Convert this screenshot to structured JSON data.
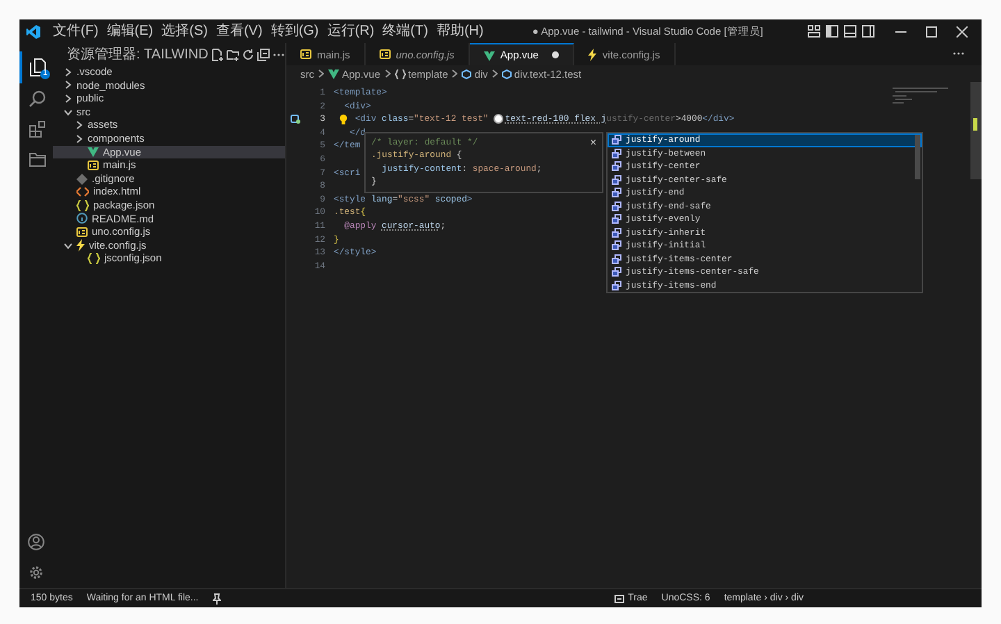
{
  "window": {
    "title": "● App.vue - tailwind - Visual Studio Code [管理员]",
    "menus": [
      "文件(F)",
      "编辑(E)",
      "选择(S)",
      "查看(V)",
      "转到(G)",
      "运行(R)",
      "终端(T)",
      "帮助(H)"
    ]
  },
  "activity_bar": {
    "items": [
      {
        "kind": "files",
        "selected": true,
        "badge": "1"
      },
      {
        "kind": "search",
        "selected": false
      },
      {
        "kind": "extensions",
        "selected": false
      },
      {
        "kind": "folder",
        "selected": false
      }
    ],
    "bottom": [
      {
        "kind": "account"
      },
      {
        "kind": "settings"
      }
    ]
  },
  "explorer": {
    "title": "资源管理器: TAILWIND",
    "items": [
      {
        "label": ".vscode",
        "kind": "folder",
        "expanded": false,
        "selected": false
      },
      {
        "label": "node_modules",
        "kind": "folder",
        "expanded": false,
        "selected": false
      },
      {
        "label": "public",
        "kind": "folder",
        "expanded": false,
        "selected": false
      },
      {
        "label": "src",
        "kind": "folder",
        "expanded": true,
        "selected": false,
        "children": [
          {
            "label": "assets",
            "kind": "folder",
            "expanded": false,
            "selected": false
          },
          {
            "label": "components",
            "kind": "folder",
            "expanded": false,
            "selected": false
          },
          {
            "label": "App.vue",
            "kind": "vue",
            "selected": true
          },
          {
            "label": "main.js",
            "kind": "js",
            "selected": false
          }
        ]
      },
      {
        "label": ".gitignore",
        "kind": "git",
        "selected": false
      },
      {
        "label": "index.html",
        "kind": "html",
        "selected": false
      },
      {
        "label": "package.json",
        "kind": "json",
        "selected": false
      },
      {
        "label": "README.md",
        "kind": "info",
        "selected": false
      },
      {
        "label": "uno.config.js",
        "kind": "js",
        "selected": false
      },
      {
        "label": "vite.config.js",
        "kind": "vite",
        "expanded": true,
        "selected": false,
        "children": [
          {
            "label": "jsconfig.json",
            "kind": "json",
            "selected": false
          }
        ]
      }
    ]
  },
  "tabs": [
    {
      "label": "main.js",
      "kind": "js",
      "selected": false,
      "preview": false,
      "modified": false
    },
    {
      "label": "uno.config.js",
      "kind": "js",
      "selected": false,
      "preview": true,
      "modified": false
    },
    {
      "label": "App.vue",
      "kind": "vue",
      "selected": true,
      "preview": false,
      "modified": true
    },
    {
      "label": "vite.config.js",
      "kind": "vite",
      "selected": false,
      "preview": false,
      "modified": false
    }
  ],
  "breadcrumb": [
    {
      "label": "src",
      "kind": "text"
    },
    {
      "label": "App.vue",
      "kind": "vue"
    },
    {
      "label": "template",
      "kind": "braces"
    },
    {
      "label": "div",
      "kind": "element"
    },
    {
      "label": "div.text-12.test",
      "kind": "element"
    }
  ],
  "editor": {
    "lines": [
      {
        "number": "1",
        "active": false,
        "tokens": [
          {
            "text": "<template>",
            "kind": "tag"
          }
        ]
      },
      {
        "number": "2",
        "active": false,
        "tokens": [
          {
            "text": "  <div>",
            "kind": "tag"
          }
        ]
      },
      {
        "number": "3",
        "active": true,
        "lightbulb": true,
        "tokens": [
          {
            "text": "    <div",
            "kind": "tag"
          },
          {
            "text": " class",
            "kind": "attr"
          },
          {
            "text": "=",
            "kind": "text"
          },
          {
            "text": "\"text-12 test\"",
            "kind": "str"
          },
          {
            "kind": "swatch"
          },
          {
            "text": "text-red-100 flex j",
            "kind": "class"
          },
          {
            "text": "ustify-center",
            "kind": "ghost"
          },
          {
            "text": ">4000",
            "kind": "text"
          },
          {
            "text": "</div>",
            "kind": "tag"
          }
        ]
      },
      {
        "number": "4",
        "active": false,
        "tokens": [
          {
            "text": "   </d",
            "kind": "tag"
          }
        ]
      },
      {
        "number": "5",
        "active": false,
        "tokens": [
          {
            "text": "</tem",
            "kind": "tag"
          }
        ]
      },
      {
        "number": "6",
        "active": false
      },
      {
        "number": "7",
        "active": false,
        "tokens": [
          {
            "text": "<scri",
            "kind": "tag"
          }
        ]
      },
      {
        "number": "8",
        "active": false
      },
      {
        "number": "9",
        "active": false,
        "tokens": [
          {
            "text": "<style",
            "kind": "tag"
          },
          {
            "text": " lang",
            "kind": "attr"
          },
          {
            "text": "=",
            "kind": "text"
          },
          {
            "text": "\"scss\"",
            "kind": "str"
          },
          {
            "text": " scoped",
            "kind": "attr"
          },
          {
            "text": ">",
            "kind": "tag"
          }
        ]
      },
      {
        "number": "10",
        "active": false,
        "tokens": [
          {
            "text": ".test",
            "kind": "selector"
          },
          {
            "text": "{",
            "kind": "brace"
          }
        ]
      },
      {
        "number": "11",
        "active": false,
        "tokens": [
          {
            "text": "  @apply ",
            "kind": "at"
          },
          {
            "text": "cursor-auto",
            "kind": "class"
          },
          {
            "text": ";",
            "kind": "text"
          }
        ]
      },
      {
        "number": "12",
        "active": false,
        "tokens": [
          {
            "text": "}",
            "kind": "brace"
          }
        ]
      },
      {
        "number": "13",
        "active": false,
        "tokens": [
          {
            "text": "</style>",
            "kind": "tag"
          }
        ]
      },
      {
        "number": "14",
        "active": false
      }
    ],
    "hover": {
      "close": "×",
      "lines": [
        {
          "tokens": [
            {
              "text": "/* layer: default */",
              "kind": "comment"
            }
          ]
        },
        {
          "tokens": [
            {
              "text": ".justify-around",
              "kind": "selector"
            },
            {
              "text": " {",
              "kind": "text"
            }
          ]
        },
        {
          "tokens": [
            {
              "text": "  justify-content",
              "kind": "attr"
            },
            {
              "text": ": ",
              "kind": "text"
            },
            {
              "text": "space-around",
              "kind": "str"
            },
            {
              "text": ";",
              "kind": "text"
            }
          ]
        },
        {
          "tokens": [
            {
              "text": "}",
              "kind": "text"
            }
          ]
        }
      ]
    },
    "suggestions": [
      {
        "label": "justify-around",
        "selected": true
      },
      {
        "label": "justify-between",
        "selected": false
      },
      {
        "label": "justify-center",
        "selected": false
      },
      {
        "label": "justify-center-safe",
        "selected": false
      },
      {
        "label": "justify-end",
        "selected": false
      },
      {
        "label": "justify-end-safe",
        "selected": false
      },
      {
        "label": "justify-evenly",
        "selected": false
      },
      {
        "label": "justify-inherit",
        "selected": false
      },
      {
        "label": "justify-initial",
        "selected": false
      },
      {
        "label": "justify-items-center",
        "selected": false
      },
      {
        "label": "justify-items-center-safe",
        "selected": false
      },
      {
        "label": "justify-items-end",
        "selected": false
      }
    ]
  },
  "status_bar": {
    "left": [
      {
        "label": "150 bytes",
        "kind": "text"
      },
      {
        "label": "Waiting for an HTML file...",
        "kind": "text"
      },
      {
        "kind": "pin"
      }
    ],
    "right": [
      {
        "label": "Trae",
        "kind": "trae"
      },
      {
        "label": "UnoCSS: 6",
        "kind": "text"
      },
      {
        "label": "template › div › div",
        "kind": "text"
      }
    ]
  }
}
